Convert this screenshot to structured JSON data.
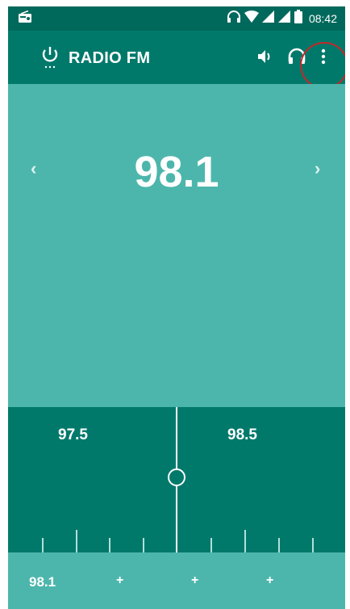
{
  "status_bar": {
    "time": "08:42",
    "icons": [
      "radio-icon",
      "headset-icon",
      "wifi-icon",
      "signal-icon",
      "signal-icon",
      "battery-icon"
    ]
  },
  "app_bar": {
    "title": "RADIO FM",
    "actions": [
      "power-icon",
      "volume-icon",
      "headset-icon",
      "more-vert-icon"
    ]
  },
  "station": {
    "frequency": "98.1",
    "prev_icon": "chevron-left-icon",
    "next_icon": "chevron-right-icon"
  },
  "tuner": {
    "left_label": "97.5",
    "right_label": "98.5"
  },
  "presets": {
    "items": [
      "98.1",
      "+",
      "+",
      "+"
    ]
  },
  "colors": {
    "status_bar": "#00695c",
    "app_bar": "#00796b",
    "background": "#4db6ac",
    "tuner": "#00796b",
    "highlight": "#c62828"
  }
}
